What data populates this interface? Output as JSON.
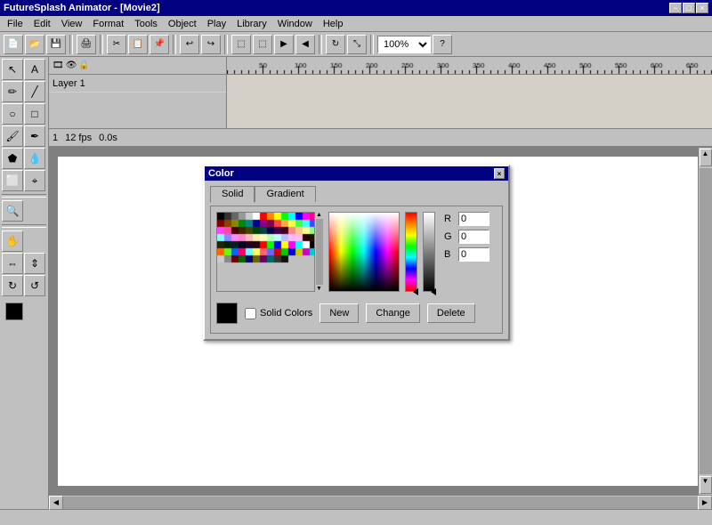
{
  "app": {
    "title": "FutureSplash Animator - [Movie2]",
    "close": "×",
    "minimize": "−",
    "maximize": "□"
  },
  "menu": {
    "items": [
      "File",
      "Edit",
      "View",
      "Format",
      "Tools",
      "Object",
      "Play",
      "Library",
      "Window",
      "Help"
    ]
  },
  "toolbar": {
    "zoom": "100%"
  },
  "timeline": {
    "layer_name": "Layer 1",
    "frame": "1",
    "fps": "12 fps",
    "time": "0.0s"
  },
  "dialog": {
    "title": "Color",
    "close": "×",
    "tabs": [
      "Solid",
      "Gradient"
    ],
    "active_tab": "Solid",
    "rgb": {
      "r_label": "R",
      "g_label": "G",
      "b_label": "B",
      "r_value": "0",
      "g_value": "0",
      "b_value": "0"
    },
    "buttons": {
      "new": "New",
      "change": "Change",
      "delete": "Delete"
    },
    "solid_colors_label": "Solid Colors"
  }
}
